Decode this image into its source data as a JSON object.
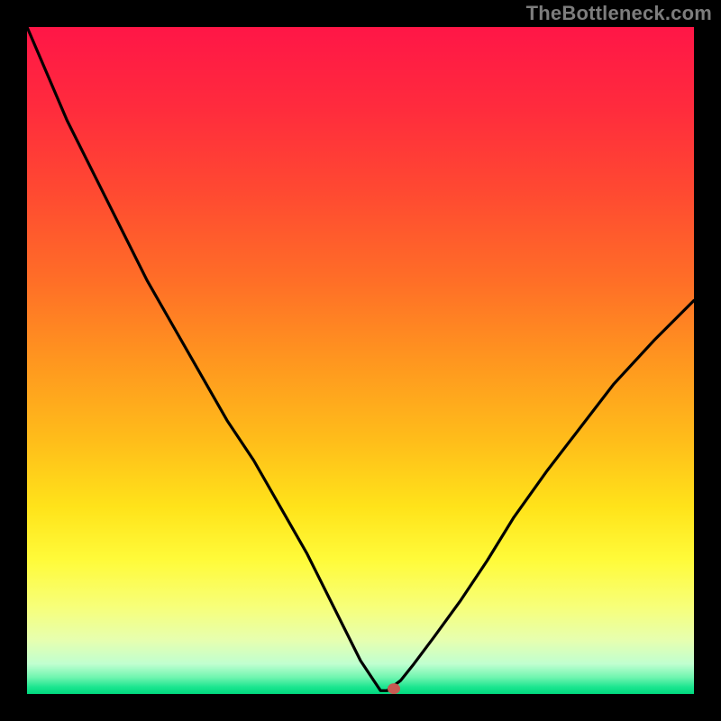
{
  "watermark": "TheBottleneck.com",
  "colors": {
    "frame": "#000000",
    "watermark_text": "#7d7d7d",
    "gradient_stops": [
      {
        "offset": 0.0,
        "color": "#ff1647"
      },
      {
        "offset": 0.12,
        "color": "#ff2b3d"
      },
      {
        "offset": 0.25,
        "color": "#ff4a31"
      },
      {
        "offset": 0.38,
        "color": "#ff6e27"
      },
      {
        "offset": 0.5,
        "color": "#ff961f"
      },
      {
        "offset": 0.62,
        "color": "#ffbd1a"
      },
      {
        "offset": 0.72,
        "color": "#ffe31a"
      },
      {
        "offset": 0.8,
        "color": "#fffb3a"
      },
      {
        "offset": 0.87,
        "color": "#f7ff7a"
      },
      {
        "offset": 0.92,
        "color": "#e6ffb0"
      },
      {
        "offset": 0.955,
        "color": "#c0ffd0"
      },
      {
        "offset": 0.975,
        "color": "#70f5b0"
      },
      {
        "offset": 0.99,
        "color": "#1ae58f"
      },
      {
        "offset": 1.0,
        "color": "#00d97e"
      }
    ],
    "curve": "#000000",
    "marker": "#c85a52"
  },
  "chart_data": {
    "type": "line",
    "title": "",
    "xlabel": "",
    "ylabel": "",
    "xlim": [
      0,
      100
    ],
    "ylim": [
      0,
      100
    ],
    "grid": false,
    "legend": false,
    "x": [
      0,
      3,
      6,
      10,
      14,
      18,
      22,
      26,
      30,
      34,
      38,
      42,
      45,
      48,
      50,
      52,
      53,
      54,
      56,
      58,
      61,
      65,
      69,
      73,
      78,
      83,
      88,
      94,
      100
    ],
    "y": [
      100,
      93,
      86,
      78,
      70,
      62,
      55,
      48,
      41,
      35,
      28,
      21,
      15,
      9,
      5,
      2,
      0.5,
      0.5,
      2,
      4.5,
      8.5,
      14,
      20,
      26.5,
      33.5,
      40,
      46.5,
      53,
      59
    ],
    "flat_minimum": {
      "x_start": 50,
      "x_end": 55,
      "y": 0.5
    },
    "marker": {
      "x": 55,
      "y": 0.8
    }
  }
}
